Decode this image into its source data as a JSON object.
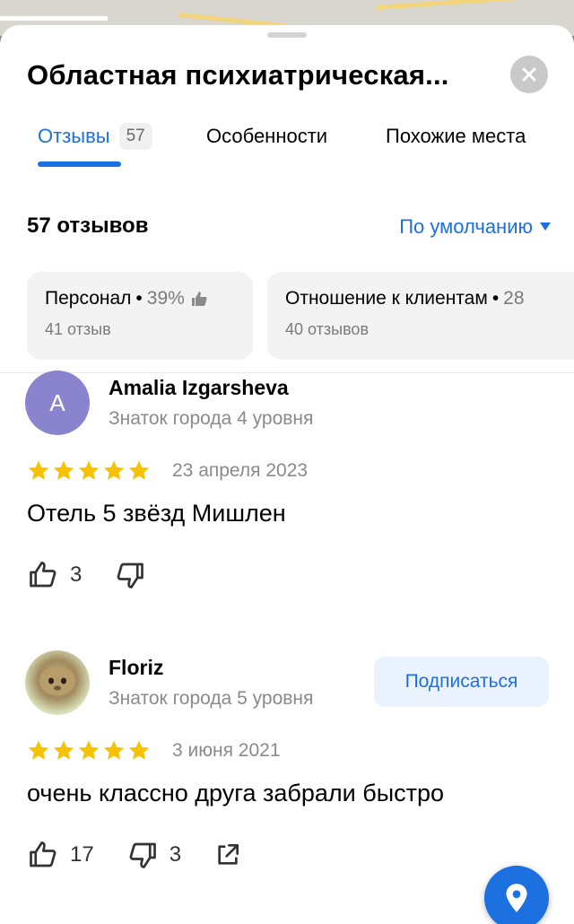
{
  "header": {
    "title": "Областная психиатрическая..."
  },
  "tabs": [
    {
      "label": "Отзывы",
      "count": "57",
      "active": true
    },
    {
      "label": "Особенности"
    },
    {
      "label": "Похожие места"
    }
  ],
  "reviews_summary": {
    "count_label": "57 отзывов",
    "sort_label": "По умолчанию"
  },
  "aspects": [
    {
      "label": "Персонал",
      "percent": "39%",
      "sub": "41 отзыв"
    },
    {
      "label": "Отношение к клиентам",
      "percent": "28",
      "sub": "40 отзывов"
    }
  ],
  "reviews": [
    {
      "avatar_letter": "A",
      "avatar_color": "#8a84cf",
      "name": "Amalia Izgarsheva",
      "level": "Знаток города 4 уровня",
      "rating": 5,
      "date": "23 апреля 2023",
      "text": "Отель 5 звёзд Мишлен",
      "likes": "3",
      "dislikes": ""
    },
    {
      "name": "Floriz",
      "level": "Знаток города 5 уровня",
      "subscribe_label": "Подписаться",
      "rating": 5,
      "date": "3 июня 2021",
      "text": "очень классно друга забрали быстро",
      "likes": "17",
      "dislikes": "3"
    }
  ],
  "colors": {
    "accent": "#1c70e0",
    "star": "#f7c203"
  }
}
